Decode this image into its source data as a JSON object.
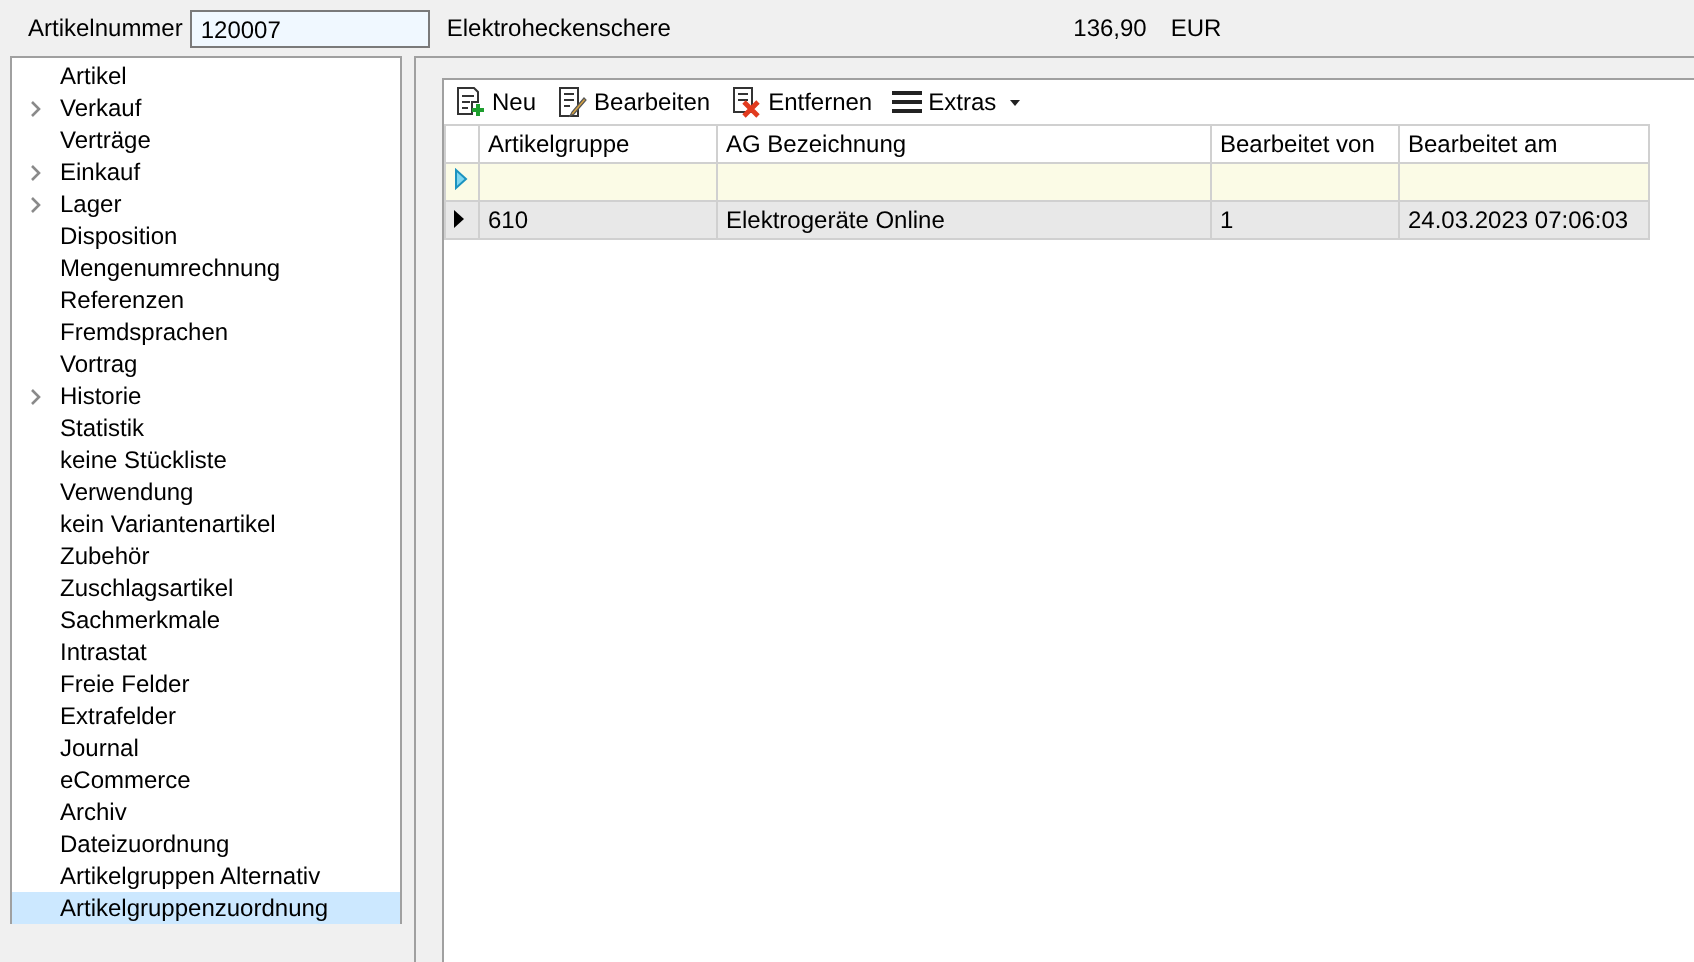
{
  "header": {
    "label": "Artikelnummer",
    "value": "120007",
    "description": "Elektroheckenschere",
    "price": "136,90",
    "currency": "EUR"
  },
  "sidebar": {
    "items": [
      {
        "label": "Artikel",
        "expandable": false,
        "selected": false
      },
      {
        "label": "Verkauf",
        "expandable": true,
        "selected": false
      },
      {
        "label": "Verträge",
        "expandable": false,
        "selected": false
      },
      {
        "label": "Einkauf",
        "expandable": true,
        "selected": false
      },
      {
        "label": "Lager",
        "expandable": true,
        "selected": false
      },
      {
        "label": "Disposition",
        "expandable": false,
        "selected": false
      },
      {
        "label": "Mengenumrechnung",
        "expandable": false,
        "selected": false
      },
      {
        "label": "Referenzen",
        "expandable": false,
        "selected": false
      },
      {
        "label": "Fremdsprachen",
        "expandable": false,
        "selected": false
      },
      {
        "label": "Vortrag",
        "expandable": false,
        "selected": false
      },
      {
        "label": "Historie",
        "expandable": true,
        "selected": false
      },
      {
        "label": "Statistik",
        "expandable": false,
        "selected": false
      },
      {
        "label": "keine Stückliste",
        "expandable": false,
        "selected": false
      },
      {
        "label": "Verwendung",
        "expandable": false,
        "selected": false
      },
      {
        "label": "kein Variantenartikel",
        "expandable": false,
        "selected": false
      },
      {
        "label": "Zubehör",
        "expandable": false,
        "selected": false
      },
      {
        "label": "Zuschlagsartikel",
        "expandable": false,
        "selected": false
      },
      {
        "label": "Sachmerkmale",
        "expandable": false,
        "selected": false
      },
      {
        "label": "Intrastat",
        "expandable": false,
        "selected": false
      },
      {
        "label": "Freie Felder",
        "expandable": false,
        "selected": false
      },
      {
        "label": "Extrafelder",
        "expandable": false,
        "selected": false
      },
      {
        "label": "Journal",
        "expandable": false,
        "selected": false
      },
      {
        "label": "eCommerce",
        "expandable": false,
        "selected": false
      },
      {
        "label": "Archiv",
        "expandable": false,
        "selected": false
      },
      {
        "label": "Dateizuordnung",
        "expandable": false,
        "selected": false
      },
      {
        "label": "Artikelgruppen Alternativ",
        "expandable": false,
        "selected": false
      },
      {
        "label": "Artikelgruppenzuordnung",
        "expandable": false,
        "selected": true
      }
    ]
  },
  "toolbar": [
    {
      "kind": "new",
      "label": "Neu"
    },
    {
      "kind": "edit",
      "label": "Bearbeiten"
    },
    {
      "kind": "delete",
      "label": "Entfernen"
    },
    {
      "kind": "menu",
      "label": "Extras"
    }
  ],
  "table": {
    "columns": [
      "Artikelgruppe",
      "AG Bezeichnung",
      "Bearbeitet von",
      "Bearbeitet am"
    ],
    "rows": [
      {
        "kind": "new",
        "cells": [
          "",
          "",
          "",
          ""
        ]
      },
      {
        "kind": "data",
        "cells": [
          "610",
          "Elektrogeräte Online",
          "1",
          "24.03.2023 07:06:03"
        ]
      }
    ]
  }
}
